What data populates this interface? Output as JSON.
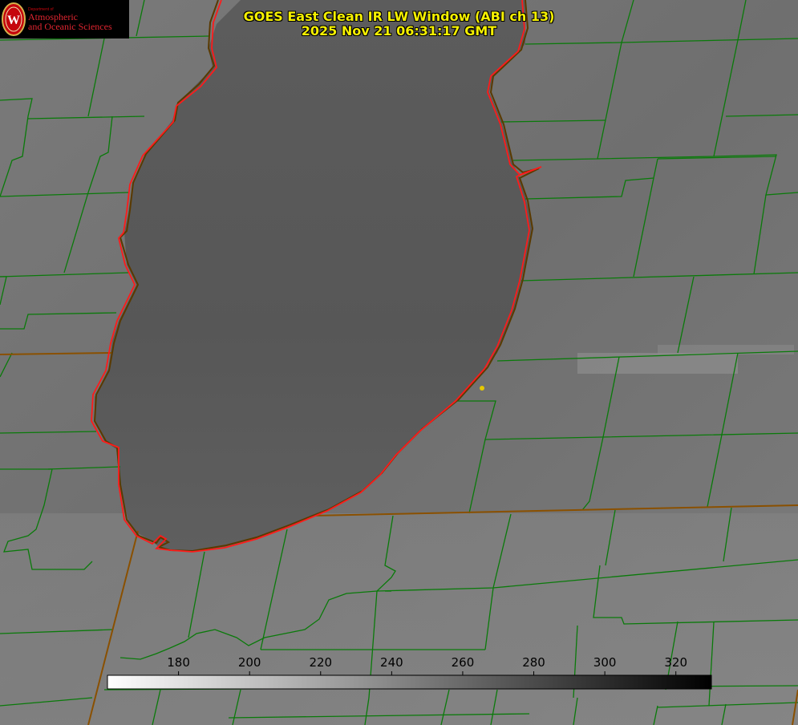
{
  "header": {
    "title": "GOES East Clean IR LW Window (ABI ch 13)",
    "timestamp": "2025 Nov 21 06:31:17 GMT"
  },
  "logo": {
    "department": "Department of",
    "line1": "Atmospheric",
    "line2": "and Oceanic Sciences",
    "seal_letter": "W",
    "colors": {
      "seal": "#c5050c",
      "text": "#e02530"
    }
  },
  "colorbar": {
    "ticks": [
      "180",
      "200",
      "220",
      "240",
      "260",
      "280",
      "300",
      "320"
    ],
    "min": 160,
    "max": 330,
    "scale": "white (cold) to black (warm) grayscale",
    "colors": {
      "cold": "#ffffff",
      "warm": "#000000"
    }
  },
  "map": {
    "feature": "lake",
    "colors": {
      "county_borders": "#0a7a0a",
      "state_borders": "#9a4a00",
      "lake_shoreline": "#ff1a1a",
      "marker": "#e6c800",
      "title_text": "#f5f000"
    }
  }
}
